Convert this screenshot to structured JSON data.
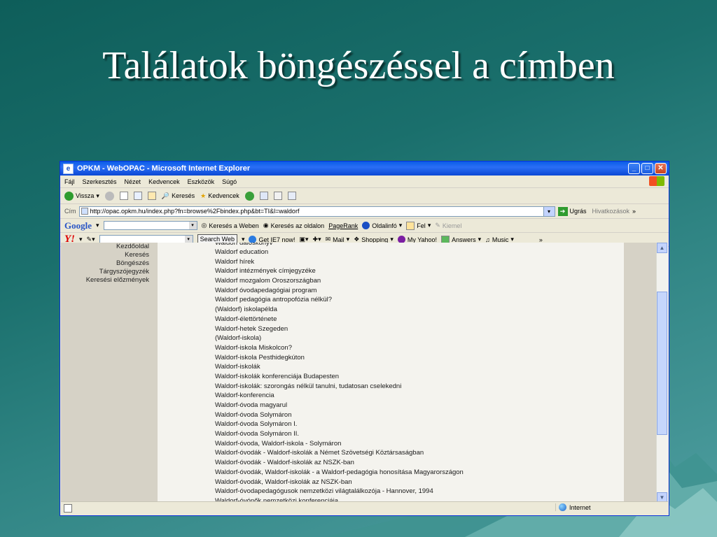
{
  "slide": {
    "title": "Találatok böngészéssel a címben"
  },
  "window": {
    "title": "OPKM - WebOPAC - Microsoft Internet Explorer",
    "minimize": "_",
    "maximize": "□",
    "close": "✕"
  },
  "menu": [
    "Fájl",
    "Szerkesztés",
    "Nézet",
    "Kedvencek",
    "Eszközök",
    "Súgó"
  ],
  "toolbar": {
    "back": "Vissza",
    "search": "Keresés",
    "favorites": "Kedvencek"
  },
  "address": {
    "label": "Cím",
    "url": "http://opac.opkm.hu/index.php?fn=browse%2Fbindex.php&bt=TI&l=waldorf",
    "go": "Ugrás",
    "links": "Hivatkozások",
    "more": "»"
  },
  "google_bar": {
    "logo": "Google",
    "search_web": "Keresés a Weben",
    "search_site": "Keresés az oldalon",
    "pagerank": "PageRank",
    "page_info": "Oldalinfó",
    "up": "Fel",
    "highlight": "Kiemel"
  },
  "yahoo_bar": {
    "logo": "Y!",
    "search_web": "Search Web",
    "get_ie7": "Get IE7 now!",
    "mail": "Mail",
    "shopping": "Shopping",
    "my_yahoo": "My Yahoo!",
    "answers": "Answers",
    "music": "Music",
    "more": "»"
  },
  "left_nav": [
    "Kezdőoldal",
    "Keresés",
    "Böngészés",
    "Tárgyszójegyzék",
    "Keresési előzmények"
  ],
  "results": [
    "Waldorf daloskönyv",
    "Waldorf education",
    "Waldorf hírek",
    "Waldorf intézmények címjegyzéke",
    "Waldorf mozgalom Oroszországban",
    "Waldorf óvodapedagógiai program",
    "Waldorf pedagógia antropofózia nélkül?",
    "(Waldorf) iskolapélda",
    "Waldorf-élettörténete",
    "Waldorf-hetek Szegeden",
    "(Waldorf-iskola)",
    "Waldorf-iskola Miskolcon?",
    "Waldorf-iskola Pesthidegkúton",
    "Waldorf-iskolák",
    "Waldorf-iskolák konferenciája Budapesten",
    "Waldorf-iskolák: szorongás nélkül tanulni, tudatosan cselekedni",
    "Waldorf-konferencia",
    "Waldorf-óvoda magyarul",
    "Waldorf-óvoda Solymáron",
    "Waldorf-óvoda Solymáron I.",
    "Waldorf-óvoda Solymáron II.",
    "Waldorf-óvoda, Waldorf-iskola - Solymáron",
    "Waldorf-óvodák - Waldorf-iskolák a Német Szövetségi Köztársaságban",
    "Waldorf-óvodák - Waldorf-iskolák az NSZK-ban",
    "Waldorf-óvodák, Waldorf-iskolák - a Waldorf-pedagógia honosítása Magyarországon",
    "Waldorf-óvodák, Waldorf-iskolák az NSZK-ban",
    "Waldorf-óvodapedagógusok nemzetközi világtalálkozója - Hannover, 1994",
    "Waldorf-óvónők nemzetközi konferenciája"
  ],
  "status": {
    "zone": "Internet"
  }
}
